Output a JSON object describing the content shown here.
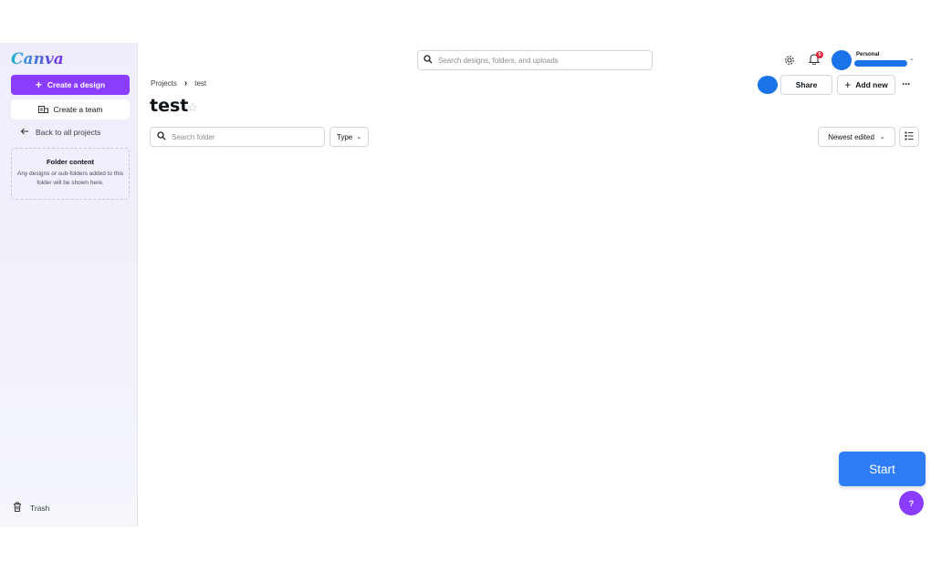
{
  "sidebar": {
    "logo": "Canva",
    "create_design_label": "Create a design",
    "create_team_label": "Create a team",
    "back_label": "Back to all projects",
    "folder_content": {
      "title": "Folder content",
      "description": "Any designs or sub-folders added to this folder will be shown here."
    },
    "trash_label": "Trash"
  },
  "header": {
    "search_placeholder": "Search designs, folders, and uploads",
    "notification_count": "5",
    "account_type": "Personal",
    "account_name": ""
  },
  "breadcrumb": {
    "root": "Projects",
    "current": "test"
  },
  "page": {
    "title": "test"
  },
  "actions": {
    "share_label": "Share",
    "add_new_label": "Add new"
  },
  "filters": {
    "search_placeholder": "Search folder",
    "type_label": "Type",
    "sort_label": "Newest edited"
  },
  "floating": {
    "start_label": "Start",
    "help_label": "?"
  },
  "colors": {
    "brand_purple": "#8b3dff",
    "start_blue": "#2e7cf6",
    "avatar_blue": "#1a73e8",
    "badge_red": "#e0263c"
  },
  "icons": [
    "search-icon",
    "gear-icon",
    "bell-icon",
    "plus-icon",
    "team-icon",
    "arrow-left-icon",
    "star-icon",
    "chevron-right-icon",
    "chevron-down-icon",
    "more-icon",
    "list-view-icon",
    "trash-icon"
  ]
}
